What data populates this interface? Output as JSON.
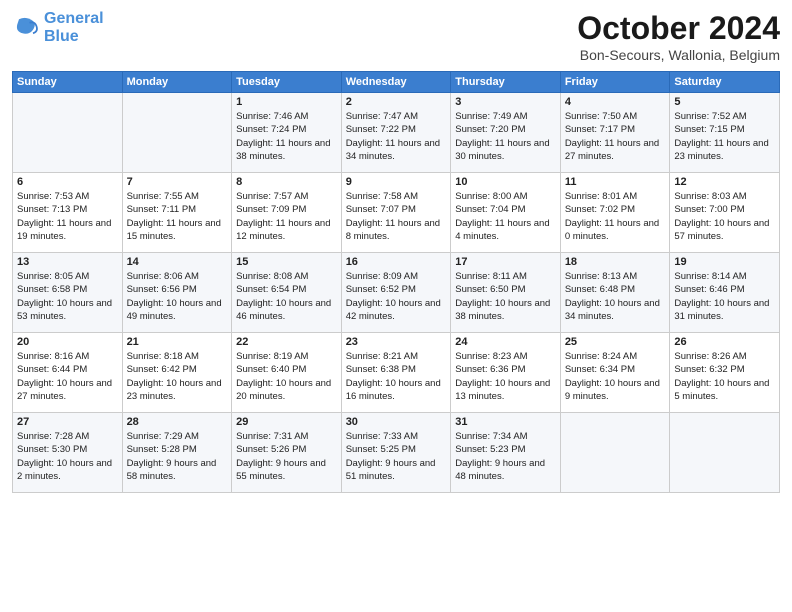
{
  "header": {
    "logo_line1": "General",
    "logo_line2": "Blue",
    "title": "October 2024",
    "subtitle": "Bon-Secours, Wallonia, Belgium"
  },
  "days_of_week": [
    "Sunday",
    "Monday",
    "Tuesday",
    "Wednesday",
    "Thursday",
    "Friday",
    "Saturday"
  ],
  "weeks": [
    [
      {
        "day": "",
        "info": ""
      },
      {
        "day": "",
        "info": ""
      },
      {
        "day": "1",
        "info": "Sunrise: 7:46 AM\nSunset: 7:24 PM\nDaylight: 11 hours and 38 minutes."
      },
      {
        "day": "2",
        "info": "Sunrise: 7:47 AM\nSunset: 7:22 PM\nDaylight: 11 hours and 34 minutes."
      },
      {
        "day": "3",
        "info": "Sunrise: 7:49 AM\nSunset: 7:20 PM\nDaylight: 11 hours and 30 minutes."
      },
      {
        "day": "4",
        "info": "Sunrise: 7:50 AM\nSunset: 7:17 PM\nDaylight: 11 hours and 27 minutes."
      },
      {
        "day": "5",
        "info": "Sunrise: 7:52 AM\nSunset: 7:15 PM\nDaylight: 11 hours and 23 minutes."
      }
    ],
    [
      {
        "day": "6",
        "info": "Sunrise: 7:53 AM\nSunset: 7:13 PM\nDaylight: 11 hours and 19 minutes."
      },
      {
        "day": "7",
        "info": "Sunrise: 7:55 AM\nSunset: 7:11 PM\nDaylight: 11 hours and 15 minutes."
      },
      {
        "day": "8",
        "info": "Sunrise: 7:57 AM\nSunset: 7:09 PM\nDaylight: 11 hours and 12 minutes."
      },
      {
        "day": "9",
        "info": "Sunrise: 7:58 AM\nSunset: 7:07 PM\nDaylight: 11 hours and 8 minutes."
      },
      {
        "day": "10",
        "info": "Sunrise: 8:00 AM\nSunset: 7:04 PM\nDaylight: 11 hours and 4 minutes."
      },
      {
        "day": "11",
        "info": "Sunrise: 8:01 AM\nSunset: 7:02 PM\nDaylight: 11 hours and 0 minutes."
      },
      {
        "day": "12",
        "info": "Sunrise: 8:03 AM\nSunset: 7:00 PM\nDaylight: 10 hours and 57 minutes."
      }
    ],
    [
      {
        "day": "13",
        "info": "Sunrise: 8:05 AM\nSunset: 6:58 PM\nDaylight: 10 hours and 53 minutes."
      },
      {
        "day": "14",
        "info": "Sunrise: 8:06 AM\nSunset: 6:56 PM\nDaylight: 10 hours and 49 minutes."
      },
      {
        "day": "15",
        "info": "Sunrise: 8:08 AM\nSunset: 6:54 PM\nDaylight: 10 hours and 46 minutes."
      },
      {
        "day": "16",
        "info": "Sunrise: 8:09 AM\nSunset: 6:52 PM\nDaylight: 10 hours and 42 minutes."
      },
      {
        "day": "17",
        "info": "Sunrise: 8:11 AM\nSunset: 6:50 PM\nDaylight: 10 hours and 38 minutes."
      },
      {
        "day": "18",
        "info": "Sunrise: 8:13 AM\nSunset: 6:48 PM\nDaylight: 10 hours and 34 minutes."
      },
      {
        "day": "19",
        "info": "Sunrise: 8:14 AM\nSunset: 6:46 PM\nDaylight: 10 hours and 31 minutes."
      }
    ],
    [
      {
        "day": "20",
        "info": "Sunrise: 8:16 AM\nSunset: 6:44 PM\nDaylight: 10 hours and 27 minutes."
      },
      {
        "day": "21",
        "info": "Sunrise: 8:18 AM\nSunset: 6:42 PM\nDaylight: 10 hours and 23 minutes."
      },
      {
        "day": "22",
        "info": "Sunrise: 8:19 AM\nSunset: 6:40 PM\nDaylight: 10 hours and 20 minutes."
      },
      {
        "day": "23",
        "info": "Sunrise: 8:21 AM\nSunset: 6:38 PM\nDaylight: 10 hours and 16 minutes."
      },
      {
        "day": "24",
        "info": "Sunrise: 8:23 AM\nSunset: 6:36 PM\nDaylight: 10 hours and 13 minutes."
      },
      {
        "day": "25",
        "info": "Sunrise: 8:24 AM\nSunset: 6:34 PM\nDaylight: 10 hours and 9 minutes."
      },
      {
        "day": "26",
        "info": "Sunrise: 8:26 AM\nSunset: 6:32 PM\nDaylight: 10 hours and 5 minutes."
      }
    ],
    [
      {
        "day": "27",
        "info": "Sunrise: 7:28 AM\nSunset: 5:30 PM\nDaylight: 10 hours and 2 minutes."
      },
      {
        "day": "28",
        "info": "Sunrise: 7:29 AM\nSunset: 5:28 PM\nDaylight: 9 hours and 58 minutes."
      },
      {
        "day": "29",
        "info": "Sunrise: 7:31 AM\nSunset: 5:26 PM\nDaylight: 9 hours and 55 minutes."
      },
      {
        "day": "30",
        "info": "Sunrise: 7:33 AM\nSunset: 5:25 PM\nDaylight: 9 hours and 51 minutes."
      },
      {
        "day": "31",
        "info": "Sunrise: 7:34 AM\nSunset: 5:23 PM\nDaylight: 9 hours and 48 minutes."
      },
      {
        "day": "",
        "info": ""
      },
      {
        "day": "",
        "info": ""
      }
    ]
  ]
}
